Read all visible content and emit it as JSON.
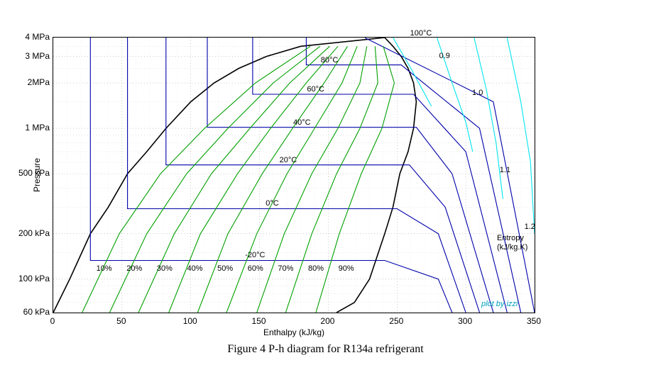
{
  "caption": "Figure 4 P-h diagram for R134a refrigerant",
  "axes": {
    "xlabel": "Enthalpy (kJ/kg)",
    "ylabel": "Pressure",
    "xticks": [
      0,
      50,
      100,
      150,
      200,
      250,
      300,
      350
    ],
    "yticks": [
      {
        "v": 60,
        "label": "60 kPa"
      },
      {
        "v": 100,
        "label": "100 kPa"
      },
      {
        "v": 200,
        "label": "200 kPa"
      },
      {
        "v": 500,
        "label": "500 kPa"
      },
      {
        "v": 1000,
        "label": "1 MPa"
      },
      {
        "v": 2000,
        "label": "2MPa"
      },
      {
        "v": 3000,
        "label": "3 MPa"
      },
      {
        "v": 4000,
        "label": "4 MPa"
      }
    ],
    "xlim": [
      0,
      350
    ],
    "ylim": [
      60,
      4000
    ]
  },
  "colors": {
    "dome": "#000",
    "isotherm": "#0000aa",
    "quality": "#00a000",
    "entropy": "#00e5ee",
    "grid": "#999"
  },
  "legend": {
    "entropy_title": "Entropy",
    "entropy_unit": "(kJ/kg.K)",
    "attribution": "plot by izzi"
  },
  "entropy_labels": [
    "0.9",
    "1.0",
    "1.1",
    "1.2"
  ],
  "isotherm_labels": [
    "-20°C",
    "0°C",
    "20°C",
    "40°C",
    "60°C",
    "80°C",
    "100°C"
  ],
  "quality_labels": [
    "10%",
    "20%",
    "30%",
    "40%",
    "50%",
    "60%",
    "70%",
    "80%",
    "90%"
  ],
  "chart_data": {
    "type": "line",
    "title": "P-h diagram for R134a refrigerant",
    "xlabel": "Enthalpy (kJ/kg)",
    "ylabel": "Pressure",
    "xlim": [
      0,
      350
    ],
    "ylim": [
      60,
      4000
    ],
    "yscale": "log",
    "series": [
      {
        "name": "saturation dome",
        "role": "dome",
        "style": "black",
        "x": [
          0,
          12,
          27,
          40,
          54,
          68,
          82,
          100,
          117,
          135,
          155,
          180,
          241,
          247,
          253,
          258,
          262,
          264,
          262,
          258,
          252,
          247,
          241,
          230,
          219,
          206
        ],
        "y": [
          60,
          100,
          200,
          300,
          500,
          700,
          1000,
          1500,
          2000,
          2500,
          3000,
          3500,
          4000,
          3500,
          3000,
          2500,
          2000,
          1500,
          1000,
          700,
          500,
          300,
          200,
          100,
          70,
          60
        ]
      },
      {
        "name": "T=-20°C",
        "role": "isotherm",
        "style": "blue",
        "x": [
          27,
          27,
          241,
          280,
          290
        ],
        "y": [
          4000,
          133,
          133,
          100,
          60
        ]
      },
      {
        "name": "T=0°C",
        "role": "isotherm",
        "style": "blue",
        "x": [
          54,
          54,
          250,
          280,
          300
        ],
        "y": [
          4000,
          293,
          293,
          200,
          60
        ]
      },
      {
        "name": "T=20°C",
        "role": "isotherm",
        "style": "blue",
        "x": [
          82,
          82,
          259,
          285,
          310
        ],
        "y": [
          4000,
          572,
          572,
          300,
          60
        ]
      },
      {
        "name": "T=40°C",
        "role": "isotherm",
        "style": "blue",
        "x": [
          112,
          112,
          264,
          290,
          320
        ],
        "y": [
          4000,
          1017,
          1017,
          500,
          60
        ]
      },
      {
        "name": "T=60°C",
        "role": "isotherm",
        "style": "blue",
        "x": [
          145,
          145,
          262,
          300,
          330
        ],
        "y": [
          4000,
          1682,
          1682,
          700,
          60
        ]
      },
      {
        "name": "T=80°C",
        "role": "isotherm",
        "style": "blue",
        "x": [
          184,
          184,
          253,
          310,
          340
        ],
        "y": [
          4000,
          2633,
          2633,
          1000,
          60
        ]
      },
      {
        "name": "T=100°C",
        "role": "isotherm",
        "style": "blue",
        "x": [
          227,
          227,
          320,
          350
        ],
        "y": [
          4000,
          3972,
          1500,
          60
        ]
      },
      {
        "name": "x=10%",
        "role": "quality",
        "style": "green",
        "x": [
          21,
          48,
          78,
          110,
          147,
          187
        ],
        "y": [
          60,
          200,
          500,
          1000,
          2000,
          3500
        ]
      },
      {
        "name": "x=20%",
        "role": "quality",
        "style": "green",
        "x": [
          41,
          68,
          97,
          127,
          160,
          194
        ],
        "y": [
          60,
          200,
          500,
          1000,
          2000,
          3500
        ]
      },
      {
        "name": "x=30%",
        "role": "quality",
        "style": "green",
        "x": [
          62,
          88,
          115,
          143,
          172,
          201
        ],
        "y": [
          60,
          200,
          500,
          1000,
          2000,
          3500
        ]
      },
      {
        "name": "x=40%",
        "role": "quality",
        "style": "green",
        "x": [
          84,
          107,
          134,
          158,
          184,
          207
        ],
        "y": [
          60,
          200,
          500,
          1000,
          2000,
          3500
        ]
      },
      {
        "name": "x=50%",
        "role": "quality",
        "style": "green",
        "x": [
          105,
          127,
          152,
          174,
          197,
          214
        ],
        "y": [
          60,
          200,
          500,
          1000,
          2000,
          3500
        ]
      },
      {
        "name": "x=60%",
        "role": "quality",
        "style": "green",
        "x": [
          126,
          148,
          170,
          190,
          210,
          221
        ],
        "y": [
          60,
          200,
          500,
          1000,
          2000,
          3500
        ]
      },
      {
        "name": "x=70%",
        "role": "quality",
        "style": "green",
        "x": [
          148,
          168,
          188,
          207,
          223,
          228
        ],
        "y": [
          60,
          200,
          500,
          1000,
          2000,
          3500
        ]
      },
      {
        "name": "x=80%",
        "role": "quality",
        "style": "green",
        "x": [
          169,
          188,
          206,
          223,
          236,
          234
        ],
        "y": [
          60,
          200,
          500,
          1000,
          2000,
          3500
        ]
      },
      {
        "name": "x=90%",
        "role": "quality",
        "style": "green",
        "x": [
          191,
          208,
          224,
          239,
          248,
          240
        ],
        "y": [
          60,
          200,
          500,
          1000,
          2000,
          3500
        ]
      },
      {
        "name": "s=0.9",
        "role": "entropy",
        "style": "cyan",
        "x": [
          247,
          260,
          275
        ],
        "y": [
          4000,
          2500,
          1400
        ]
      },
      {
        "name": "s=1.0",
        "role": "entropy",
        "style": "cyan",
        "x": [
          279,
          290,
          300,
          305
        ],
        "y": [
          4000,
          2000,
          1100,
          700
        ]
      },
      {
        "name": "s=1.1",
        "role": "entropy",
        "style": "cyan",
        "x": [
          306,
          315,
          322,
          327
        ],
        "y": [
          4000,
          1800,
          800,
          340
        ]
      },
      {
        "name": "s=1.2",
        "role": "entropy",
        "style": "cyan",
        "x": [
          330,
          340,
          347,
          350
        ],
        "y": [
          4000,
          1500,
          600,
          200
        ]
      }
    ]
  }
}
